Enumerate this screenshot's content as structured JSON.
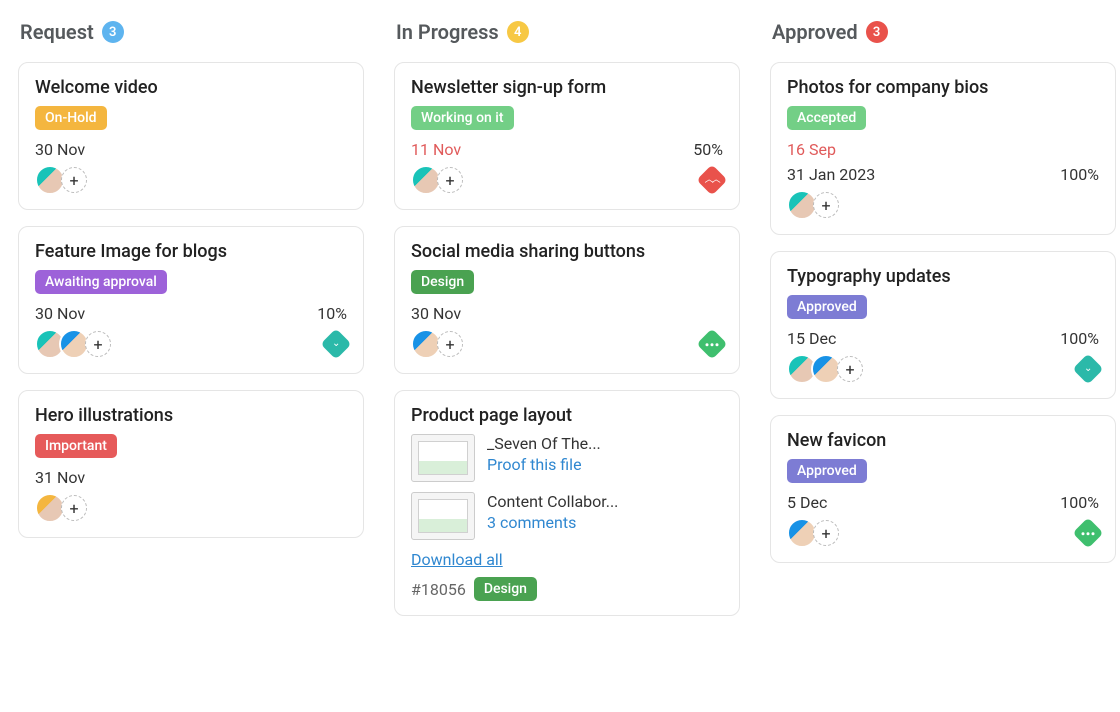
{
  "columns": [
    {
      "title": "Request",
      "count": 3,
      "count_color": "bg-blue",
      "cards": [
        {
          "title": "Welcome video",
          "tag": {
            "label": "On-Hold",
            "class": "tag-onhold"
          },
          "date": "30 Nov",
          "overdue": false,
          "percent": null,
          "avatars": [
            "a1"
          ],
          "priority": null
        },
        {
          "title": "Feature Image for blogs",
          "tag": {
            "label": "Awaiting approval",
            "class": "tag-awaiting"
          },
          "date": "30 Nov",
          "overdue": false,
          "percent": "10%",
          "avatars": [
            "a1",
            "a2"
          ],
          "priority": {
            "class": "teal",
            "kind": "chevron-down"
          }
        },
        {
          "title": "Hero illustrations",
          "tag": {
            "label": "Important",
            "class": "tag-important"
          },
          "date": "31 Nov",
          "overdue": false,
          "percent": null,
          "avatars": [
            "a3"
          ],
          "priority": null
        }
      ]
    },
    {
      "title": "In Progress",
      "count": 4,
      "count_color": "bg-yellow",
      "cards": [
        {
          "title": "Newsletter sign-up form",
          "tag": {
            "label": "Working on it",
            "class": "tag-working"
          },
          "date": "11 Nov",
          "overdue": true,
          "percent": "50%",
          "avatars": [
            "a1"
          ],
          "priority": {
            "class": "redd",
            "kind": "double-up"
          }
        },
        {
          "title": "Social media sharing buttons",
          "tag": {
            "label": "Design",
            "class": "tag-design"
          },
          "date": "30 Nov",
          "overdue": false,
          "percent": null,
          "avatars": [
            "a2"
          ],
          "priority": {
            "class": "green",
            "kind": "dots"
          }
        },
        {
          "title": "Product page layout",
          "attachments": [
            {
              "name": "_Seven Of The...",
              "action": "Proof this file"
            },
            {
              "name": "Content Collabor...",
              "action": "3 comments"
            }
          ],
          "download": "Download all",
          "task_id": "#18056",
          "tag_inline": {
            "label": "Design",
            "class": "tag-design"
          }
        }
      ]
    },
    {
      "title": "Approved",
      "count": 3,
      "count_color": "bg-red",
      "cards": [
        {
          "title": "Photos for company bios",
          "tag": {
            "label": "Accepted",
            "class": "tag-accepted"
          },
          "date": "16 Sep",
          "overdue": true,
          "date2": "31 Jan 2023",
          "percent": "100%",
          "avatars": [
            "a1"
          ],
          "priority": null
        },
        {
          "title": "Typography updates",
          "tag": {
            "label": "Approved",
            "class": "tag-approved"
          },
          "date": "15 Dec",
          "overdue": false,
          "percent": "100%",
          "avatars": [
            "a1",
            "a2"
          ],
          "priority": {
            "class": "teal",
            "kind": "chevron-down"
          }
        },
        {
          "title": "New favicon",
          "tag": {
            "label": "Approved",
            "class": "tag-approved"
          },
          "date": "5 Dec",
          "overdue": false,
          "percent": "100%",
          "avatars": [
            "a2"
          ],
          "priority": {
            "class": "green",
            "kind": "dots"
          }
        }
      ]
    }
  ]
}
